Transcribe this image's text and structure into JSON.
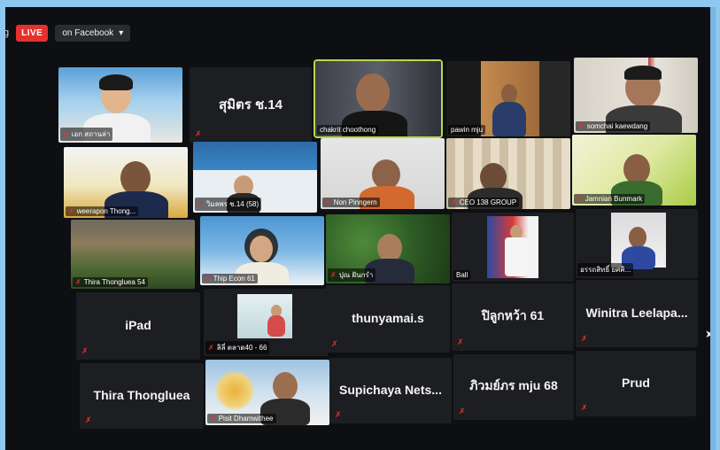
{
  "topbar": {
    "cut_text": "g",
    "live_label": "LIVE",
    "stream_label": "on Facebook",
    "dropdown_icon": "caret-down"
  },
  "colors": {
    "live_red": "#e5322f",
    "active_speaker": "#b7d94a",
    "tile_bg": "#1d1e22"
  },
  "tiles": [
    {
      "id": "t1",
      "label": "เอก สถานล่า",
      "type": "video"
    },
    {
      "id": "t2",
      "label": "สุมิตร ช.14",
      "type": "text"
    },
    {
      "id": "t3",
      "label": "chakrit choothong",
      "type": "video",
      "active": true
    },
    {
      "id": "t4",
      "label": "pawin mju",
      "type": "video"
    },
    {
      "id": "t5",
      "label": "somchai kaewdang",
      "type": "video"
    },
    {
      "id": "t6",
      "label": "weerapon Thong...",
      "type": "video"
    },
    {
      "id": "t7",
      "label": "วิมลพร ช.14 (58)",
      "type": "video"
    },
    {
      "id": "t8",
      "label": "Non Pinngern",
      "type": "video"
    },
    {
      "id": "t9",
      "label": "CEO 138 GROUP",
      "type": "video"
    },
    {
      "id": "t10",
      "label": "Jamnian Bunmark",
      "type": "video"
    },
    {
      "id": "t11",
      "label": "Thira Thongluea 54",
      "type": "video"
    },
    {
      "id": "t12",
      "label": "Thip Econ 61",
      "type": "video"
    },
    {
      "id": "t13",
      "label": "ปุณ ฝันกรำ",
      "type": "video"
    },
    {
      "id": "t14",
      "label": "Ball",
      "type": "video"
    },
    {
      "id": "t15",
      "label": "อรรถสิทธิ์ ยศคิ...",
      "type": "video"
    },
    {
      "id": "t16",
      "label": "iPad",
      "type": "text"
    },
    {
      "id": "t17",
      "label": "ลิลี่ ตลาด40 - 66",
      "type": "video"
    },
    {
      "id": "t18",
      "label": "thunyamai.s",
      "type": "text"
    },
    {
      "id": "t19",
      "label": "ปิลูกหว้า 61",
      "type": "text"
    },
    {
      "id": "t20",
      "label": "Winitra Leelapa...",
      "type": "text"
    },
    {
      "id": "t21",
      "label": "Thira Thongluea",
      "type": "text"
    },
    {
      "id": "t22",
      "label": "Pisit Dhamwithee",
      "type": "video"
    },
    {
      "id": "t23",
      "label": "Supichaya Nets...",
      "type": "text"
    },
    {
      "id": "t24",
      "label": "ภิวมย์ภร mju 68",
      "type": "text"
    },
    {
      "id": "t25",
      "label": "Prud",
      "type": "text"
    }
  ]
}
